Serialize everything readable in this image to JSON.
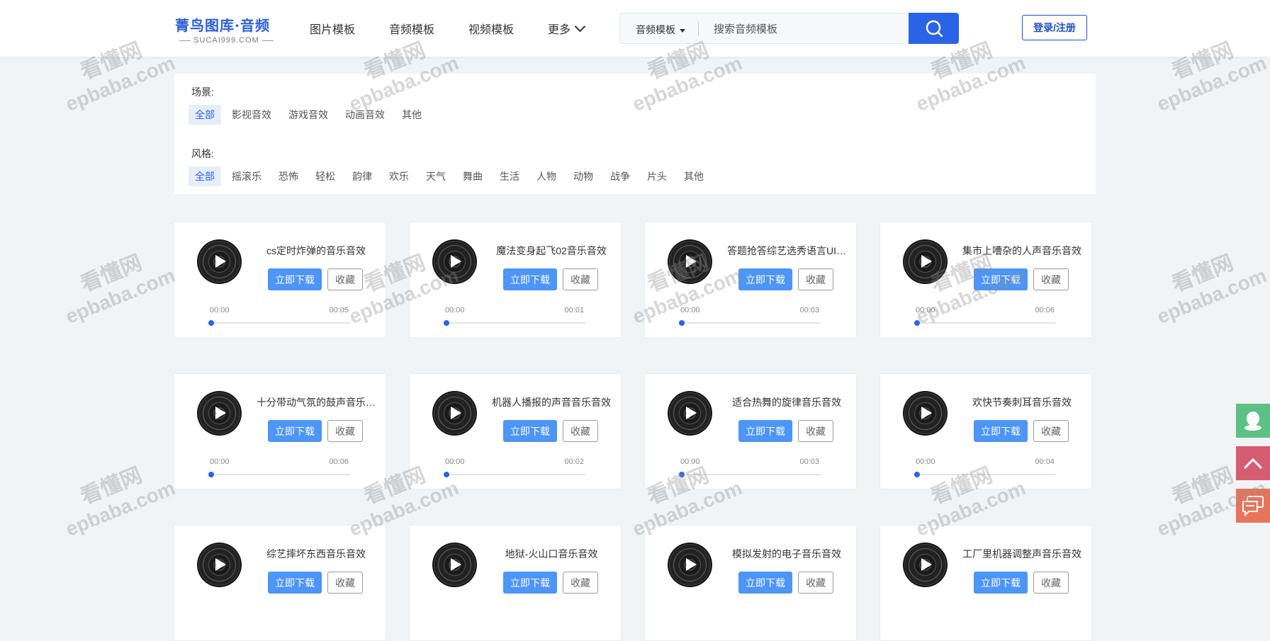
{
  "header": {
    "logo_main": "菁鸟图库·音频",
    "logo_sub": "SUCAI999.COM",
    "nav": [
      "图片模板",
      "音频模板",
      "视频模板",
      "更多"
    ],
    "search_type": "音频模板",
    "search_placeholder": "搜索音频模板",
    "login_label": "登录/注册"
  },
  "filters": {
    "scene_label": "场景:",
    "scene_options": [
      "全部",
      "影视音效",
      "游戏音效",
      "动画音效",
      "其他"
    ],
    "style_label": "风格:",
    "style_options": [
      "全部",
      "摇滚乐",
      "恐怖",
      "轻松",
      "韵律",
      "欢乐",
      "天气",
      "舞曲",
      "生活",
      "人物",
      "动物",
      "战争",
      "片头",
      "其他"
    ]
  },
  "card_labels": {
    "download": "立即下载",
    "favorite": "收藏",
    "current_time": "00:00"
  },
  "cards": [
    {
      "title": "cs定时炸弹的音乐音效",
      "duration": "00:05"
    },
    {
      "title": "魔法变身起飞02音乐音效",
      "duration": "00:01"
    },
    {
      "title": "答题抢答综艺选秀语言UI…",
      "duration": "00:03"
    },
    {
      "title": "集市上嘈杂的人声音乐音效",
      "duration": "00:06"
    },
    {
      "title": "十分带动气氛的鼓声音乐…",
      "duration": "00:06"
    },
    {
      "title": "机器人播报的声音音乐音效",
      "duration": "00:02"
    },
    {
      "title": "适合热舞的旋律音乐音效",
      "duration": "00:03"
    },
    {
      "title": "欢快节奏刺耳音乐音效",
      "duration": "00:04"
    },
    {
      "title": "综艺摔坏东西音乐音效",
      "duration": ""
    },
    {
      "title": "地狱-火山口音乐音效",
      "duration": ""
    },
    {
      "title": "模拟发射的电子音乐音效",
      "duration": ""
    },
    {
      "title": "工厂里机器调整声音乐音效",
      "duration": ""
    }
  ],
  "watermark": {
    "line1": "看懂网",
    "line2": "epbaba.com"
  },
  "colors": {
    "accent": "#2a63e8",
    "download_button": "#4d95f6",
    "qq": "#5cc184",
    "top": "#d65c72",
    "chat": "#e8745c"
  },
  "side_tools": [
    "qq-icon",
    "back-to-top-icon",
    "chat-icon"
  ]
}
